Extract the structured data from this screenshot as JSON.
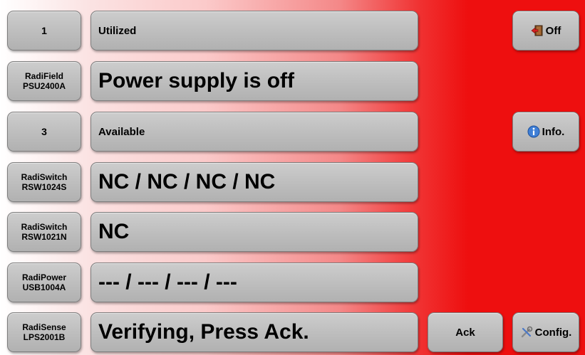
{
  "rows": [
    {
      "slot": [
        "1"
      ],
      "status": "Utilized",
      "size": "small"
    },
    {
      "slot": [
        "RadiField",
        "PSU2400A"
      ],
      "status": "Power supply is off",
      "size": "big"
    },
    {
      "slot": [
        "3"
      ],
      "status": "Available",
      "size": "small"
    },
    {
      "slot": [
        "RadiSwitch",
        "RSW1024S"
      ],
      "status": "NC / NC / NC / NC",
      "size": "big"
    },
    {
      "slot": [
        "RadiSwitch",
        "RSW1021N"
      ],
      "status": "NC",
      "size": "big"
    },
    {
      "slot": [
        "RadiPower",
        "USB1004A"
      ],
      "status": "--- / --- / --- / ---",
      "size": "big"
    },
    {
      "slot": [
        "RadiSense",
        "LPS2001B"
      ],
      "status": "Verifying, Press Ack.",
      "size": "big"
    }
  ],
  "buttons": {
    "off": {
      "label": "Off",
      "icon": "exit-door-icon"
    },
    "info": {
      "label": "Info.",
      "icon": "info-icon"
    },
    "ack": {
      "label": "Ack"
    },
    "config": {
      "label": "Config.",
      "icon": "tools-icon"
    }
  },
  "colors": {
    "background_accent": "#ee0f0f",
    "button": "#c4c4c4"
  }
}
